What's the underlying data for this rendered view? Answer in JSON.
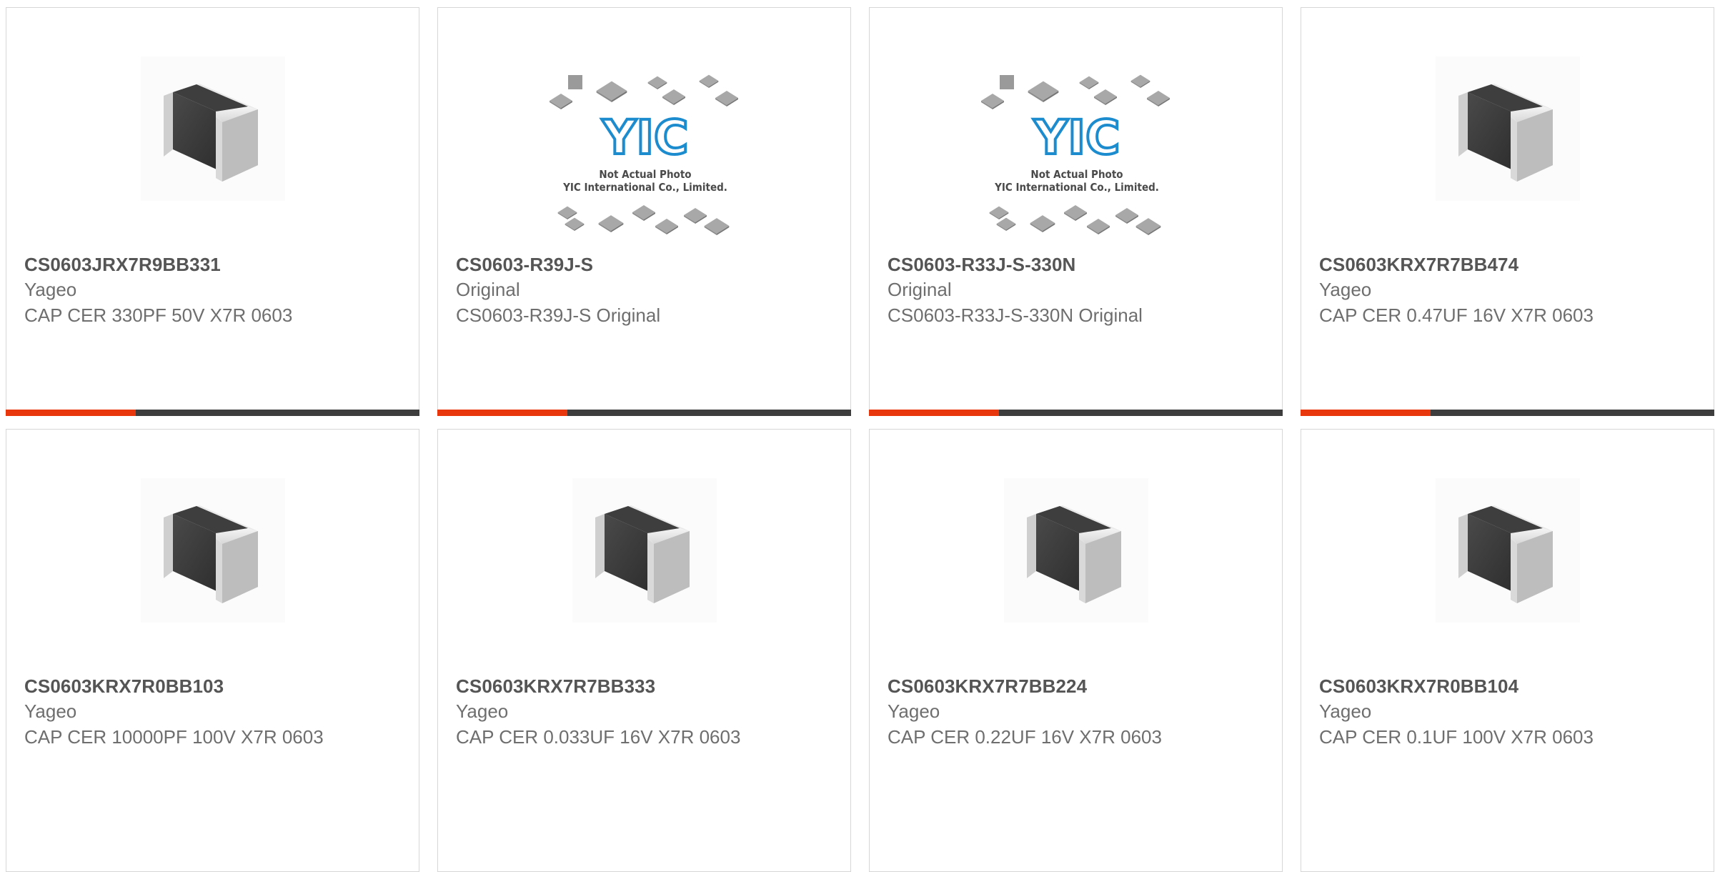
{
  "products": [
    {
      "part_number": "CS0603JRX7R9BB331",
      "manufacturer": "Yageo",
      "description": "CAP CER 330PF 50V X7R 0603",
      "image": "chip-capacitor-image"
    },
    {
      "part_number": "CS0603-R39J-S",
      "manufacturer": "Original",
      "description": "CS0603-R39J-S Original",
      "image": "not-actual-photo-image",
      "image_text": {
        "brand": "YIC",
        "line1": "Not Actual Photo",
        "line2": "YIC International Co., Limited."
      }
    },
    {
      "part_number": "CS0603-R33J-S-330N",
      "manufacturer": "Original",
      "description": "CS0603-R33J-S-330N Original",
      "image": "not-actual-photo-image",
      "image_text": {
        "brand": "YIC",
        "line1": "Not Actual Photo",
        "line2": "YIC International Co., Limited."
      }
    },
    {
      "part_number": "CS0603KRX7R7BB474",
      "manufacturer": "Yageo",
      "description": "CAP CER 0.47UF 16V X7R 0603",
      "image": "chip-capacitor-image"
    },
    {
      "part_number": "CS0603KRX7R0BB103",
      "manufacturer": "Yageo",
      "description": "CAP CER 10000PF 100V X7R 0603",
      "image": "chip-capacitor-image"
    },
    {
      "part_number": "CS0603KRX7R7BB333",
      "manufacturer": "Yageo",
      "description": "CAP CER 0.033UF 16V X7R 0603",
      "image": "chip-capacitor-image"
    },
    {
      "part_number": "CS0603KRX7R7BB224",
      "manufacturer": "Yageo",
      "description": "CAP CER 0.22UF 16V X7R 0603",
      "image": "chip-capacitor-image"
    },
    {
      "part_number": "CS0603KRX7R0BB104",
      "manufacturer": "Yageo",
      "description": "CAP CER 0.1UF 100V X7R 0603",
      "image": "chip-capacitor-image"
    }
  ],
  "colors": {
    "accent": "#e8360d",
    "bar": "#3d3d3d",
    "border": "#d6d6d6",
    "part_text": "#555555",
    "meta_text": "#6e6e6e",
    "logo_blue": "#1d8ccf"
  }
}
